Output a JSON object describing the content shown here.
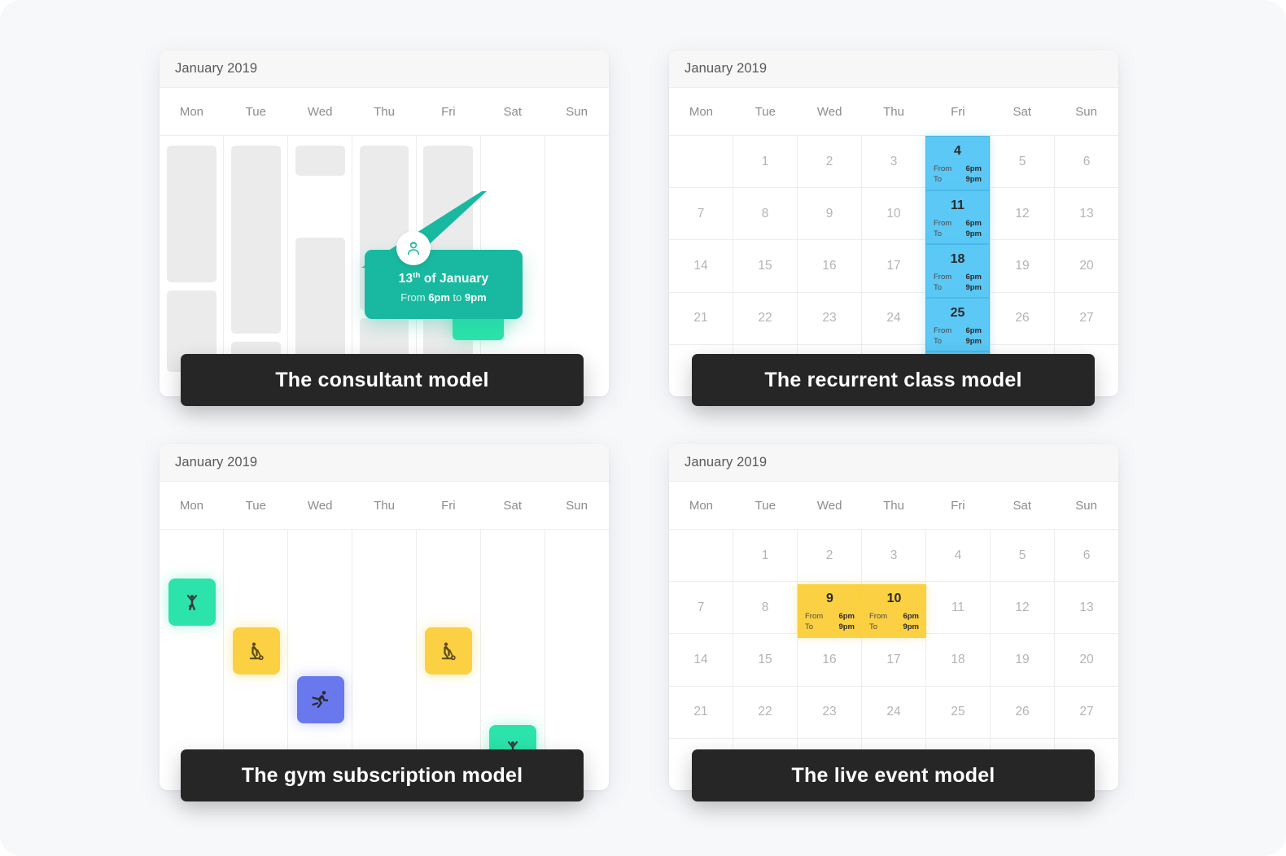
{
  "page": {
    "background": "#f7f8fa"
  },
  "colors": {
    "green": "#2ce3ab",
    "teal": "#18b9a0",
    "blue": "#5bc8f5",
    "yellow": "#fbd042",
    "indigo": "#6a78ee",
    "caption_bg": "#262626"
  },
  "weekdays": [
    "Mon",
    "Tue",
    "Wed",
    "Thu",
    "Fri",
    "Sat",
    "Sun"
  ],
  "cards": [
    {
      "id": "consultant",
      "month": "January 2019",
      "caption": "The consultant model",
      "tooltip": {
        "day": "13",
        "ordinal": "th",
        "of_month": " of January",
        "time_prefix": "From ",
        "time_from": "6pm",
        "time_join": " to ",
        "time_to": "9pm",
        "avatar_icon": "person-icon"
      }
    },
    {
      "id": "recurrent-class",
      "month": "January 2019",
      "caption": "The recurrent class model",
      "weeks": [
        [
          "",
          "1",
          "2",
          "3",
          "4",
          "5",
          "6"
        ],
        [
          "7",
          "8",
          "9",
          "10",
          "11",
          "12",
          "13"
        ],
        [
          "14",
          "15",
          "16",
          "17",
          "18",
          "19",
          "20"
        ],
        [
          "21",
          "22",
          "23",
          "24",
          "25",
          "26",
          "27"
        ],
        [
          "",
          "",
          "",
          "",
          "",
          "",
          ""
        ]
      ],
      "events": [
        {
          "day": "4",
          "from_label": "From",
          "from": "6pm",
          "to_label": "To",
          "to": "9pm"
        },
        {
          "day": "11",
          "from_label": "From",
          "from": "6pm",
          "to_label": "To",
          "to": "9pm"
        },
        {
          "day": "18",
          "from_label": "From",
          "from": "6pm",
          "to_label": "To",
          "to": "9pm"
        },
        {
          "day": "25",
          "from_label": "From",
          "from": "6pm",
          "to_label": "To",
          "to": "9pm"
        }
      ]
    },
    {
      "id": "gym-subscription",
      "month": "January 2019",
      "caption": "The gym subscription model",
      "badges": [
        {
          "icon": "yoga-icon",
          "color": "green"
        },
        {
          "icon": "stepper-icon",
          "color": "yellow"
        },
        {
          "icon": "running-icon",
          "color": "blue"
        },
        {
          "icon": "stepper-icon",
          "color": "yellow"
        },
        {
          "icon": "yoga-icon",
          "color": "green"
        }
      ]
    },
    {
      "id": "live-event",
      "month": "January 2019",
      "caption": "The live event model",
      "weeks": [
        [
          "",
          "1",
          "2",
          "3",
          "4",
          "5",
          "6"
        ],
        [
          "7",
          "8",
          "9",
          "10",
          "11",
          "12",
          "13"
        ],
        [
          "14",
          "15",
          "16",
          "17",
          "18",
          "19",
          "20"
        ],
        [
          "21",
          "22",
          "23",
          "24",
          "25",
          "26",
          "27"
        ],
        [
          "",
          "",
          "",
          "",
          "",
          "",
          ""
        ]
      ],
      "events": [
        {
          "day": "9",
          "from_label": "From",
          "from": "6pm",
          "to_label": "To",
          "to": "9pm"
        },
        {
          "day": "10",
          "from_label": "From",
          "from": "6pm",
          "to_label": "To",
          "to": "9pm"
        }
      ]
    }
  ]
}
